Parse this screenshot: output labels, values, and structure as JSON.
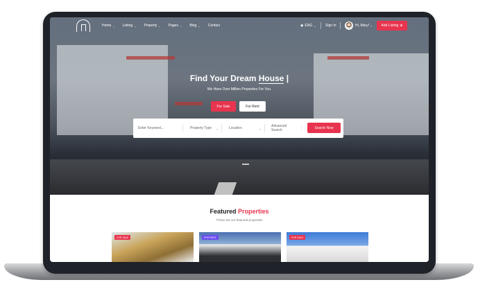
{
  "header": {
    "nav_items": [
      {
        "label": "Home"
      },
      {
        "label": "Listing"
      },
      {
        "label": "Property"
      },
      {
        "label": "Pages"
      },
      {
        "label": "Blog"
      },
      {
        "label": "Contact"
      }
    ],
    "language": "ENG",
    "sign_in": "Sign In",
    "user_greeting": "Hi, Mary!",
    "add_listing": "Add Listing"
  },
  "hero": {
    "title_prefix": "Find Your Dream",
    "title_highlight": "House",
    "title_cursor": "|",
    "subtitle": "We Have Over Million Properties For You.",
    "tabs": [
      {
        "label": "For Sale",
        "active": true
      },
      {
        "label": "For Rent",
        "active": false
      }
    ]
  },
  "search": {
    "keyword_placeholder": "Enter Keyword...",
    "property_type": "Property Type",
    "location": "Location",
    "advanced": "Advanced Search",
    "button": "Search Now"
  },
  "featured": {
    "title_plain": "Featured",
    "title_accent": "Properties",
    "subtitle": "These are our featured properties",
    "cards": [
      {
        "badge": "FOR SALE",
        "badge_color": "#e8344e"
      },
      {
        "badge": "FOR RENT",
        "badge_color": "#6c4cf0"
      },
      {
        "badge": "FOR SALE",
        "badge_color": "#e8344e"
      }
    ]
  },
  "colors": {
    "accent": "#e8344e",
    "rent_badge": "#6c4cf0"
  }
}
